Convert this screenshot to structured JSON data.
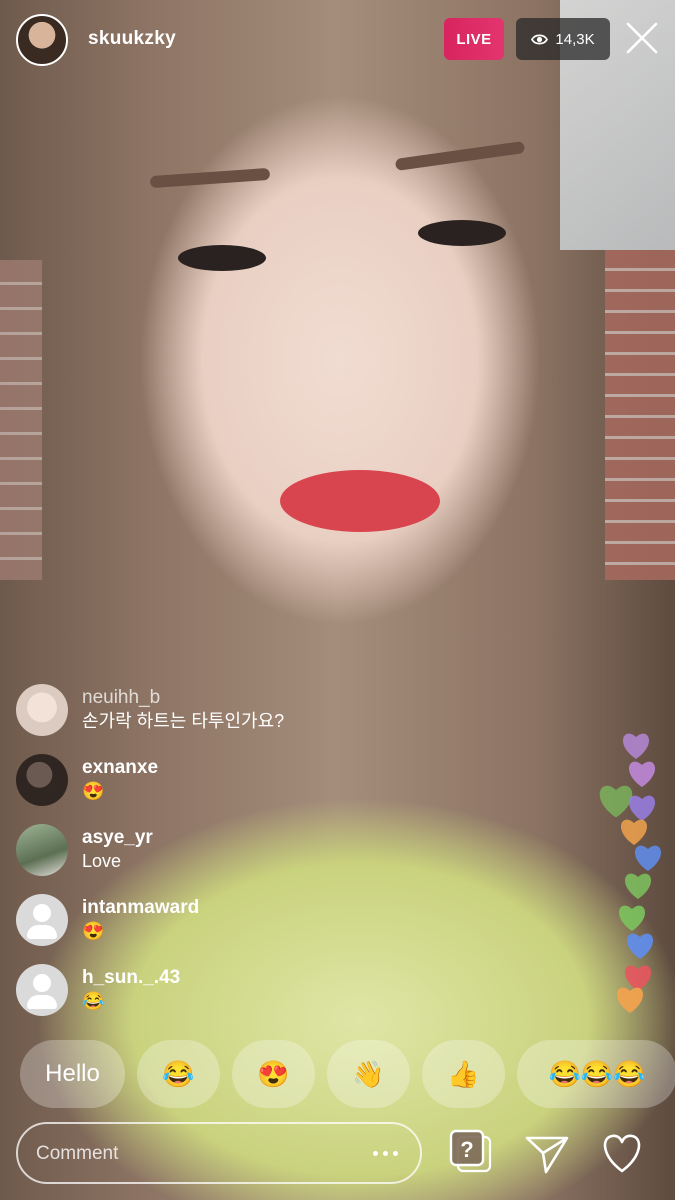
{
  "header": {
    "username": "skuukzky",
    "live_label": "LIVE",
    "viewer_count": "14,3K"
  },
  "comments": [
    {
      "username": "neuihh_b",
      "message": "손가락 하트는 타투인가요?"
    },
    {
      "username": "exnanxe",
      "message": "😍"
    },
    {
      "username": "asye_yr",
      "message": "Love"
    },
    {
      "username": "intanmaward",
      "message": "😍"
    },
    {
      "username": "h_sun._.43",
      "message": "😂"
    }
  ],
  "quick_replies": [
    "Hello",
    "😂",
    "😍",
    "👋",
    "👍",
    "😂😂😂"
  ],
  "footer": {
    "comment_placeholder": "Comment"
  },
  "colors": {
    "live": "#d8245f",
    "heart_colors": [
      "#b98be0",
      "#7cc35e",
      "#5f8ef0",
      "#f0a24e",
      "#e8555f"
    ]
  },
  "icons": [
    "eye-icon",
    "close-icon",
    "question-cards-icon",
    "send-icon",
    "heart-icon",
    "more-dots-icon"
  ]
}
